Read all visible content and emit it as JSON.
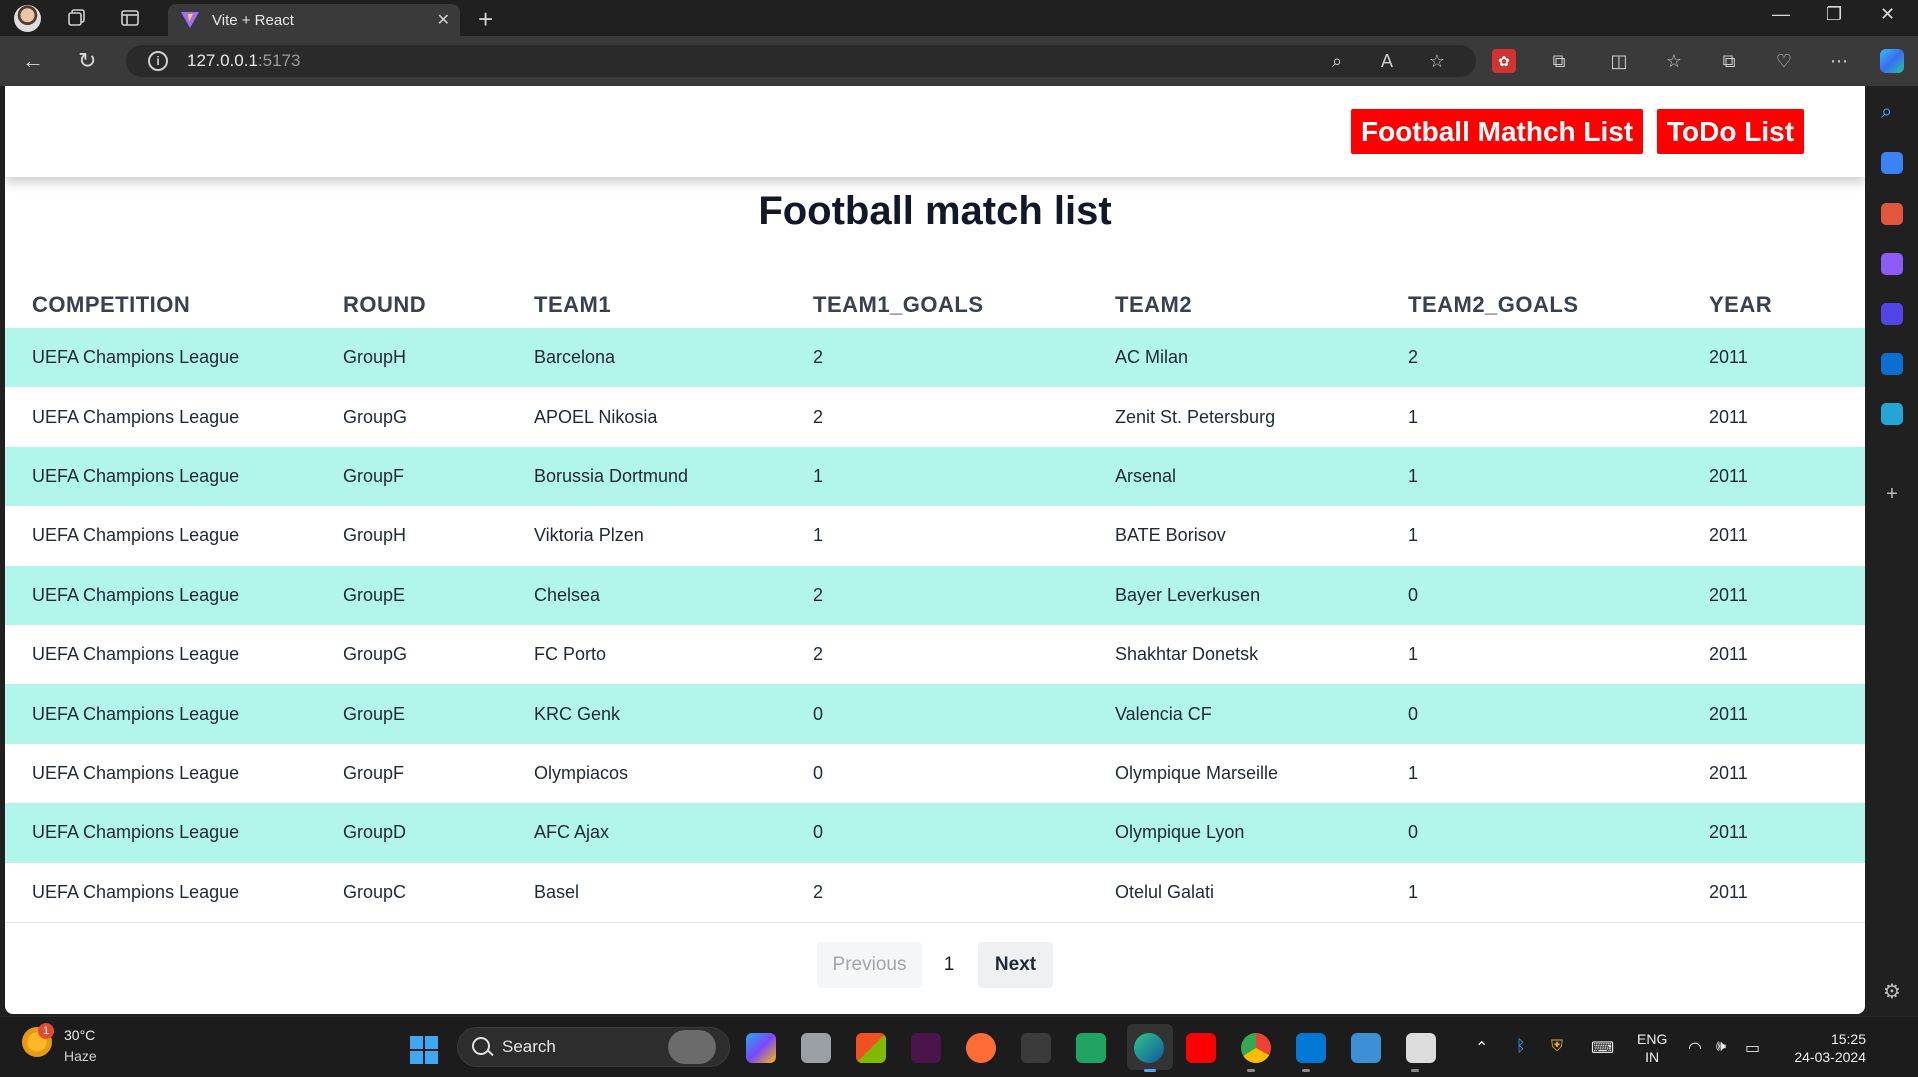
{
  "browser": {
    "tab_title": "Vite + React",
    "url_host": "127.0.0.1",
    "url_port": ":5173"
  },
  "navbar": {
    "link1": "Football Mathch List",
    "link2": "ToDo List"
  },
  "page": {
    "title": "Football match list"
  },
  "table": {
    "headers": [
      "COMPETITION",
      "ROUND",
      "TEAM1",
      "TEAM1_GOALS",
      "TEAM2",
      "TEAM2_GOALS",
      "YEAR"
    ],
    "rows": [
      [
        "UEFA Champions League",
        "GroupH",
        "Barcelona",
        "2",
        "AC Milan",
        "2",
        "2011"
      ],
      [
        "UEFA Champions League",
        "GroupG",
        "APOEL Nikosia",
        "2",
        "Zenit St. Petersburg",
        "1",
        "2011"
      ],
      [
        "UEFA Champions League",
        "GroupF",
        "Borussia Dortmund",
        "1",
        "Arsenal",
        "1",
        "2011"
      ],
      [
        "UEFA Champions League",
        "GroupH",
        "Viktoria Plzen",
        "1",
        "BATE Borisov",
        "1",
        "2011"
      ],
      [
        "UEFA Champions League",
        "GroupE",
        "Chelsea",
        "2",
        "Bayer Leverkusen",
        "0",
        "2011"
      ],
      [
        "UEFA Champions League",
        "GroupG",
        "FC Porto",
        "2",
        "Shakhtar Donetsk",
        "1",
        "2011"
      ],
      [
        "UEFA Champions League",
        "GroupE",
        "KRC Genk",
        "0",
        "Valencia CF",
        "0",
        "2011"
      ],
      [
        "UEFA Champions League",
        "GroupF",
        "Olympiacos",
        "0",
        "Olympique Marseille",
        "1",
        "2011"
      ],
      [
        "UEFA Champions League",
        "GroupD",
        "AFC Ajax",
        "0",
        "Olympique Lyon",
        "0",
        "2011"
      ],
      [
        "UEFA Champions League",
        "GroupC",
        "Basel",
        "2",
        "Otelul Galati",
        "1",
        "2011"
      ]
    ]
  },
  "pagination": {
    "previous": "Previous",
    "page": "1",
    "next": "Next"
  },
  "taskbar": {
    "weather_temp": "30°C",
    "weather_desc": "Haze",
    "weather_badge": "1",
    "search_placeholder": "Search",
    "lang_line1": "ENG",
    "lang_line2": "IN",
    "time": "15:25",
    "date": "24-03-2024"
  },
  "colors": {
    "nav_button": "#ff0000",
    "row_stripe": "#b2f5ea"
  }
}
